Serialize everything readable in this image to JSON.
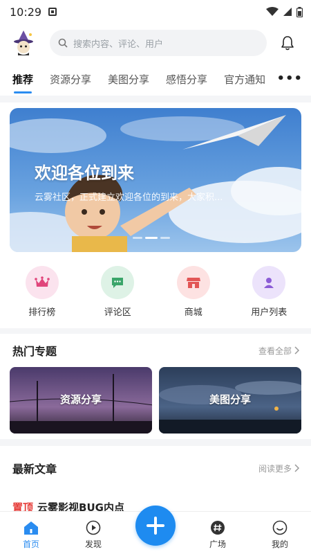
{
  "status_bar": {
    "time": "10:29"
  },
  "search": {
    "placeholder": "搜索内容、评论、用户"
  },
  "tabs": [
    {
      "label": "推荐",
      "active": true
    },
    {
      "label": "资源分享"
    },
    {
      "label": "美图分享"
    },
    {
      "label": "感悟分享"
    },
    {
      "label": "官方通知"
    }
  ],
  "tabs_more": "•••",
  "banner": {
    "title": "欢迎各位到来",
    "subtitle": "云雾社区，正式建立欢迎各位的到来，大家积..."
  },
  "quick_actions": [
    {
      "label": "排行榜",
      "icon": "crown-icon",
      "bg": "#fbe3ee",
      "fg": "#e0457b"
    },
    {
      "label": "评论区",
      "icon": "chat-icon",
      "bg": "#def2e6",
      "fg": "#3aa56a"
    },
    {
      "label": "商城",
      "icon": "store-icon",
      "bg": "#fde2e2",
      "fg": "#e25555"
    },
    {
      "label": "用户列表",
      "icon": "user-icon",
      "bg": "#ece3fb",
      "fg": "#8b5cd6"
    }
  ],
  "hot_topics": {
    "title": "热门专题",
    "more": "查看全部",
    "items": [
      {
        "label": "资源分享"
      },
      {
        "label": "美图分享"
      }
    ]
  },
  "latest": {
    "title": "最新文章",
    "more": "阅读更多",
    "peek_pin": "置顶",
    "peek_title": "云雾影视BUG内点"
  },
  "bottom_nav": [
    {
      "label": "首页",
      "icon": "home-icon",
      "active": true
    },
    {
      "label": "发现",
      "icon": "discover-icon"
    },
    {
      "label": "广场",
      "icon": "hash-icon"
    },
    {
      "label": "我的",
      "icon": "profile-icon"
    }
  ],
  "colors": {
    "accent": "#2a8cf0",
    "fab": "#1e8bf0",
    "pin": "#e53935"
  }
}
